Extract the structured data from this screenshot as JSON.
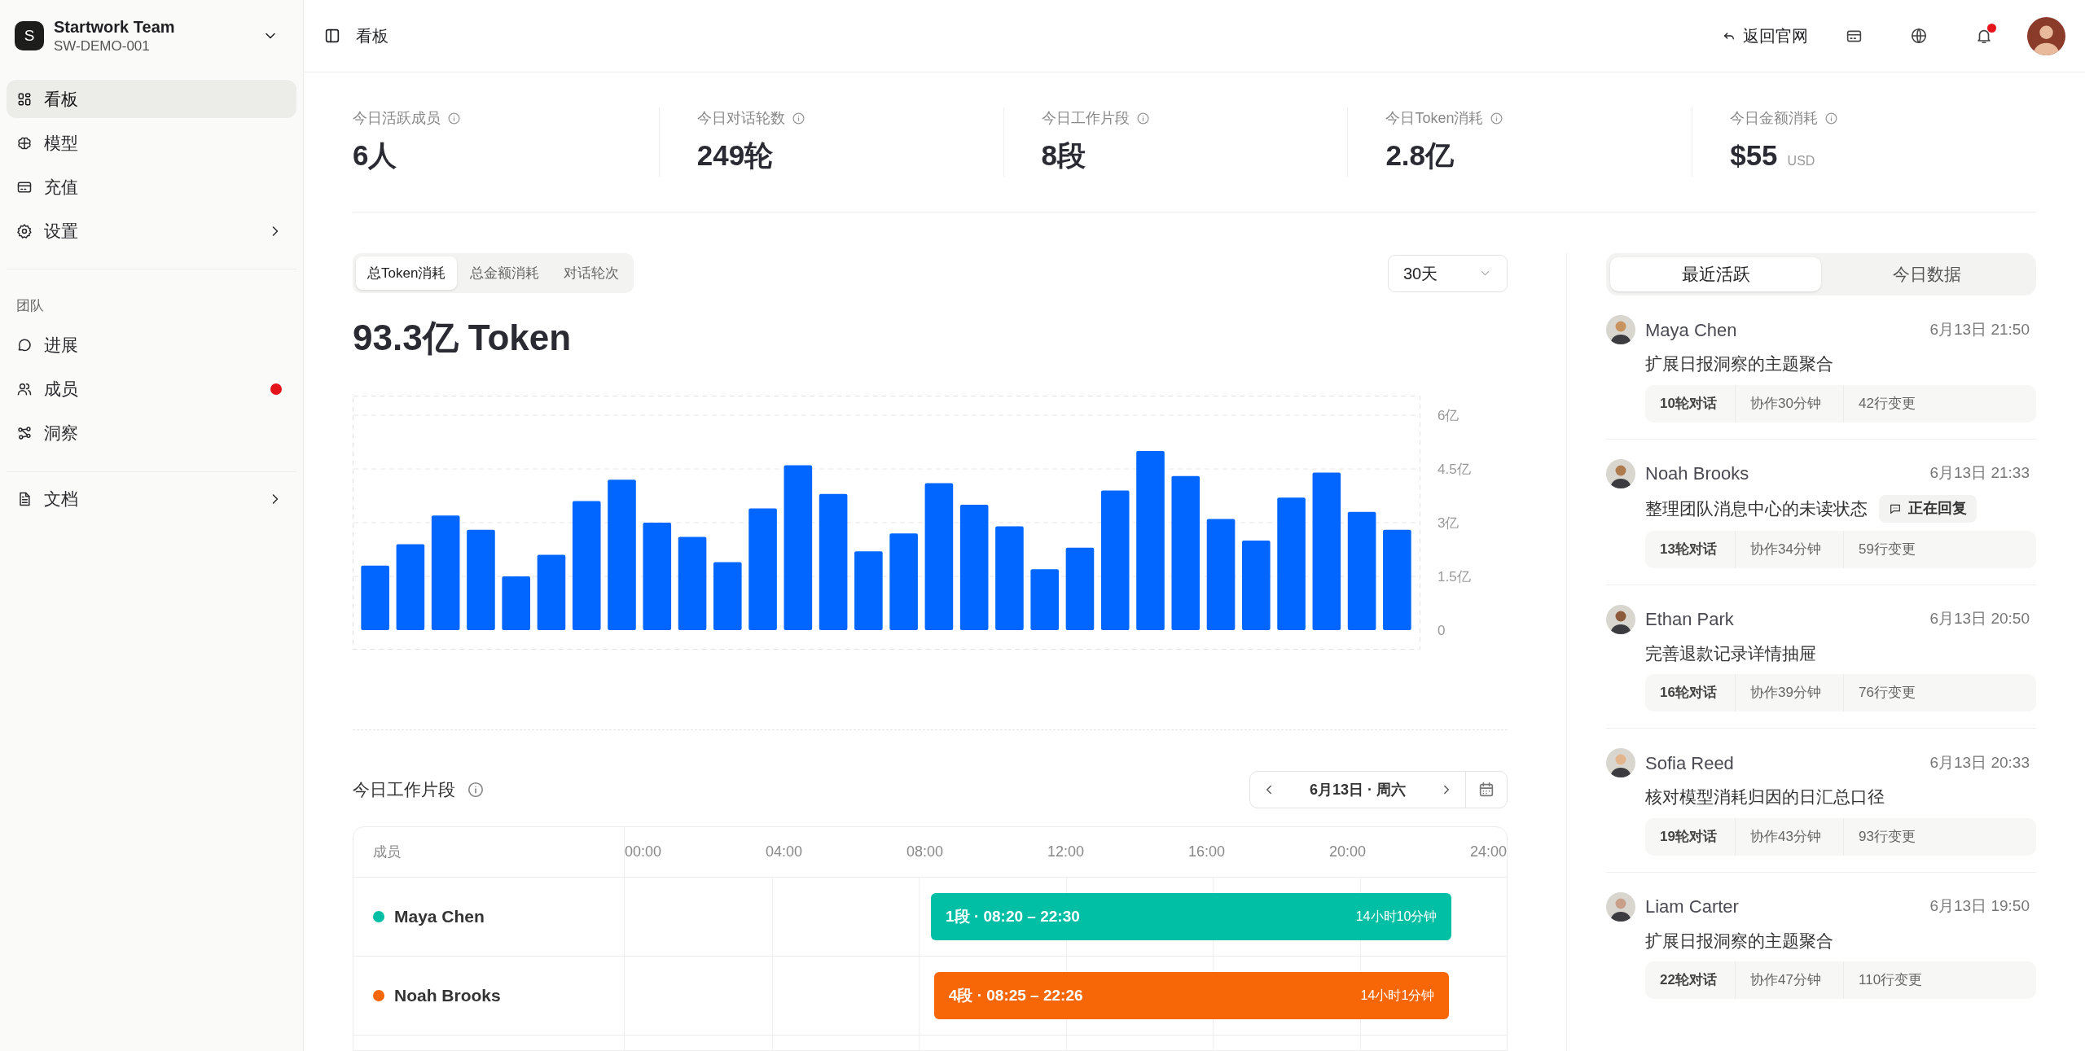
{
  "sidebar": {
    "team": {
      "letter": "S",
      "name": "Startwork Team",
      "code": "SW-DEMO-001"
    },
    "sections": [
      {
        "items": [
          {
            "label": "看板",
            "selected": true,
            "expandable": false,
            "notification": false
          },
          {
            "label": "模型",
            "selected": false,
            "expandable": false,
            "notification": false
          },
          {
            "label": "充值",
            "selected": false,
            "expandable": false,
            "notification": false
          },
          {
            "label": "设置",
            "selected": false,
            "expandable": true,
            "notification": false
          }
        ]
      },
      {
        "title": "团队",
        "items": [
          {
            "label": "进展",
            "selected": false,
            "expandable": false,
            "notification": false
          },
          {
            "label": "成员",
            "selected": false,
            "expandable": false,
            "notification": true
          },
          {
            "label": "洞察",
            "selected": false,
            "expandable": false,
            "notification": false
          }
        ]
      },
      {
        "items": [
          {
            "label": "文档",
            "selected": false,
            "expandable": true,
            "notification": false
          }
        ]
      }
    ]
  },
  "header": {
    "title": "看板",
    "back_link": "返回官网",
    "notification": true
  },
  "stats": [
    {
      "label": "今日活跃成员",
      "value": "6人"
    },
    {
      "label": "今日对话轮数",
      "value": "249轮"
    },
    {
      "label": "今日工作片段",
      "value": "8段"
    },
    {
      "label": "今日Token消耗",
      "value": "2.8亿"
    },
    {
      "label": "今日金额消耗",
      "value": "$55",
      "unit": "USD"
    }
  ],
  "chart_panel": {
    "tabs": [
      {
        "label": "总Token消耗",
        "selected": true
      },
      {
        "label": "总金额消耗",
        "selected": false
      },
      {
        "label": "对话轮次",
        "selected": false
      }
    ],
    "range": "30天",
    "total": "93.3亿 Token",
    "chart_data": {
      "type": "bar",
      "grid": true,
      "ylim": [
        0,
        6
      ],
      "yticks": [
        {
          "value": 0,
          "label": "0"
        },
        {
          "value": 1.5,
          "label": "1.5亿"
        },
        {
          "value": 3,
          "label": "3亿"
        },
        {
          "value": 4.5,
          "label": "4.5亿"
        },
        {
          "value": 6,
          "label": "6亿"
        }
      ],
      "series": [
        {
          "color": "#0066ff",
          "values": [
            1.8,
            2.4,
            3.2,
            2.8,
            1.5,
            2.1,
            3.6,
            4.2,
            3.0,
            2.6,
            1.9,
            3.4,
            4.6,
            3.8,
            2.2,
            2.7,
            4.1,
            3.5,
            2.9,
            1.7,
            2.3,
            3.9,
            5.0,
            4.3,
            3.1,
            2.5,
            3.7,
            4.4,
            3.3,
            2.8
          ]
        }
      ]
    }
  },
  "timeline": {
    "title": "今日工作片段",
    "date": "6月13日 · 周六",
    "member_header": "成员",
    "hours": [
      "00:00",
      "04:00",
      "08:00",
      "12:00",
      "16:00",
      "20:00",
      "24:00"
    ],
    "rows": [
      {
        "name": "Maya Chen",
        "color": "#00bfa5",
        "label": "1段 · 08:20 – 22:30",
        "duration": "14小时10分钟"
      },
      {
        "name": "Noah Brooks",
        "color": "#f76707",
        "label": "4段 · 08:25 – 22:26",
        "duration": "14小时1分钟"
      }
    ]
  },
  "activity": {
    "tabs": [
      {
        "label": "最近活跃",
        "selected": true
      },
      {
        "label": "今日数据",
        "selected": false
      }
    ],
    "items": [
      {
        "name": "Maya Chen",
        "time": "6月13日 21:50",
        "task": "扩展日报洞察的主题聚合",
        "stats": [
          "10轮对话",
          "协作30分钟",
          "42行变更"
        ]
      },
      {
        "name": "Noah Brooks",
        "time": "6月13日 21:33",
        "task": "整理团队消息中心的未读状态",
        "status": "正在回复",
        "stats": [
          "13轮对话",
          "协作34分钟",
          "59行变更"
        ]
      },
      {
        "name": "Ethan Park",
        "time": "6月13日 20:50",
        "task": "完善退款记录详情抽屉",
        "stats": [
          "16轮对话",
          "协作39分钟",
          "76行变更"
        ]
      },
      {
        "name": "Sofia Reed",
        "time": "6月13日 20:33",
        "task": "核对模型消耗归因的日汇总口径",
        "stats": [
          "19轮对话",
          "协作43分钟",
          "93行变更"
        ]
      },
      {
        "name": "Liam Carter",
        "time": "6月13日 19:50",
        "task": "扩展日报洞察的主题聚合",
        "stats": [
          "22轮对话",
          "协作47分钟",
          "110行变更"
        ]
      }
    ]
  }
}
